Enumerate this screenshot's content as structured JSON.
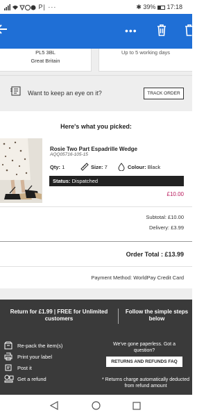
{
  "status_bar": {
    "left_text": "P|  ···",
    "battery": "39%",
    "time": "17:18"
  },
  "app_bar": {
    "back_icon": "arrow-left-icon",
    "more_icon": "more-dots-icon",
    "delete_icon": "trash-icon"
  },
  "address_card": {
    "postcode": "PL5 3BL",
    "country": "Great Britain"
  },
  "delivery_card": {
    "text": "Up to 5 working days"
  },
  "watch": {
    "prompt": "Want to keep an eye on it?",
    "track_button": "TRACK ORDER"
  },
  "order": {
    "heading": "Here's what you picked:",
    "item": {
      "name": "Rosie Two Part Espadrille Wedge",
      "code": "AQQ05716-105-15",
      "qty_label": "Qty:",
      "qty": "1",
      "size_label": "Size:",
      "size": "7",
      "colour_label": "Colour:",
      "colour": "Black",
      "status_label": "Status:",
      "status": "Dispatched",
      "price": "£10.00"
    },
    "subtotal": "Subtotal: £10.00",
    "delivery": "Delivery: £3.99",
    "order_total": "Order Total : £13.99",
    "payment_method": "Payment Method: WorldPay Credit Card"
  },
  "returns": {
    "left_title": "Return for £1.99 | FREE for Unlimited customers",
    "right_title": "Follow the simple steps below",
    "steps": [
      {
        "label": "Re-pack the item(s)",
        "icon": "box-icon"
      },
      {
        "label": "Print your label",
        "icon": "printer-icon"
      },
      {
        "label": "Post it",
        "icon": "post-icon"
      },
      {
        "label": "Get a refund",
        "icon": "refund-icon"
      }
    ],
    "paperless": "We've gone paperless. Got a question?",
    "faq_button": "RETURNS AND REFUNDS FAQ",
    "charge_note": "* Returns charge automatically deducted from refund amount"
  },
  "colors": {
    "app_bar": "#1f6fd6",
    "price": "#b8185a",
    "returns_panel": "#3a3a3a",
    "status_bar_bg": "#222222"
  }
}
